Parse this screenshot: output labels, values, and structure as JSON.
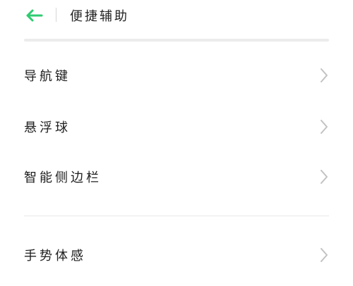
{
  "header": {
    "title": "便捷辅助",
    "back_icon": "arrow-left-icon",
    "accent_color": "#2ecc71"
  },
  "items": [
    {
      "label": "导航键"
    },
    {
      "label": "悬浮球"
    },
    {
      "label": "智能侧边栏"
    },
    {
      "label": "手势体感"
    }
  ],
  "icons": {
    "row_chevron": "chevron-right-icon"
  }
}
